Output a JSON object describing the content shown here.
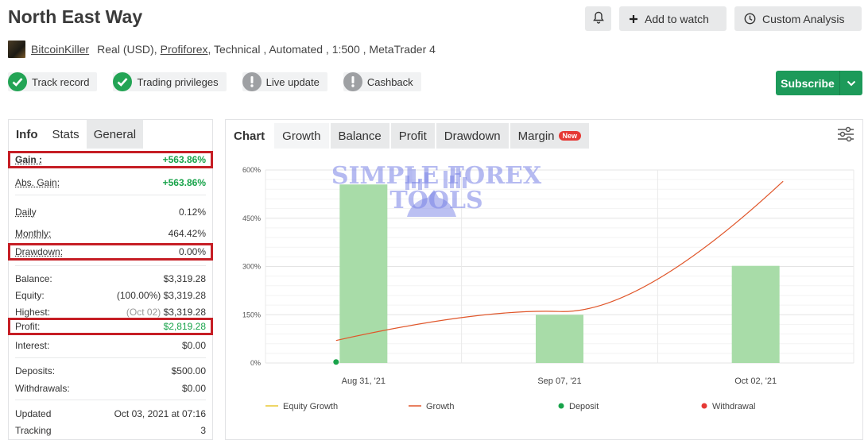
{
  "header": {
    "title": "North East Way",
    "add_to_watch": "Add to watch",
    "custom_analysis": "Custom Analysis"
  },
  "account": {
    "user": "BitcoinKiller",
    "type": "Real (USD),",
    "broker": "Profiforex",
    "rest": ", Technical , Automated , 1:500 , MetaTrader 4"
  },
  "badges": [
    {
      "label": "Track record",
      "state": "verified"
    },
    {
      "label": "Trading privileges",
      "state": "verified"
    },
    {
      "label": "Live update",
      "state": "unverified"
    },
    {
      "label": "Cashback",
      "state": "unverified"
    }
  ],
  "subscribe": {
    "label": "Subscribe"
  },
  "left_tabs": [
    "Info",
    "Stats",
    "General"
  ],
  "stats": {
    "gain": {
      "label": "Gain :",
      "value": "+563.86%"
    },
    "abs_gain": {
      "label": "Abs. Gain:",
      "value": "+563.86%"
    },
    "daily": {
      "label": "Daily",
      "value": "0.12%"
    },
    "monthly": {
      "label": "Monthly:",
      "value": "464.42%"
    },
    "drawdown": {
      "label": "Drawdown:",
      "value": "0.00%"
    },
    "balance": {
      "label": "Balance:",
      "value": "$3,319.28"
    },
    "equity": {
      "label": "Equity:",
      "pct": "(100.00%)",
      "value": "$3,319.28"
    },
    "highest": {
      "label": "Highest:",
      "date": "(Oct 02)",
      "value": "$3,319.28"
    },
    "profit": {
      "label": "Profit:",
      "value": "$2,819.28"
    },
    "interest": {
      "label": "Interest:",
      "value": "$0.00"
    },
    "deposits": {
      "label": "Deposits:",
      "value": "$500.00"
    },
    "withdrawals": {
      "label": "Withdrawals:",
      "value": "$0.00"
    },
    "updated": {
      "label": "Updated",
      "value": "Oct 03, 2021 at 07:16"
    },
    "tracking": {
      "label": "Tracking",
      "value": "3"
    }
  },
  "chart_tabs": {
    "chart": "Chart",
    "growth": "Growth",
    "balance": "Balance",
    "profit": "Profit",
    "drawdown": "Drawdown",
    "margin": "Margin",
    "new_badge": "New"
  },
  "watermark": {
    "line1": "SIMPLE FOREX",
    "line2": "TOOLS"
  },
  "colors": {
    "bar": "#a8dca8",
    "growth_line": "#e0562a",
    "equity_line": "#e8c832",
    "deposit": "#18a34a",
    "withdrawal": "#e53935",
    "highlight": "#c61e25"
  },
  "chart_data": {
    "type": "bar",
    "categories": [
      "Aug 31, '21",
      "Sep 07, '21",
      "Oct 02, '21"
    ],
    "yticks": [
      "0%",
      "150%",
      "300%",
      "450%",
      "600%"
    ],
    "ylim": [
      0,
      600
    ],
    "bars": [
      555,
      150,
      302
    ],
    "growth_line": [
      [
        0.12,
        70
      ],
      [
        0.5,
        160
      ],
      [
        0.88,
        565
      ]
    ],
    "deposit_points": [
      [
        0.12,
        3
      ]
    ],
    "legend": [
      "Equity Growth",
      "Growth",
      "Deposit",
      "Withdrawal"
    ]
  }
}
